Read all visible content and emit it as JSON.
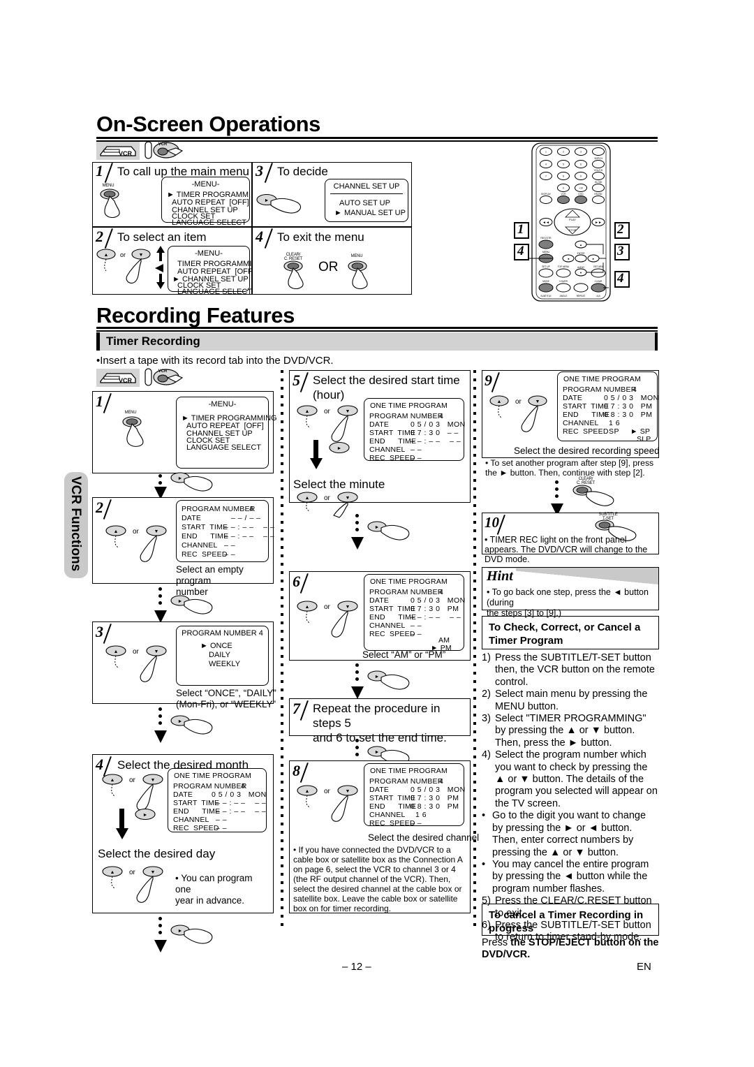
{
  "page": {
    "number": "– 12 –",
    "lang": "EN",
    "side_tab": "VCR Functions"
  },
  "headings": {
    "h1_a": "On-Screen Operations",
    "h1_b": "Recording Features",
    "section": "Timer Recording",
    "intro_bullet": "•Insert a tape with its record tab into the DVD/VCR."
  },
  "icons": {
    "vcr_deck": "vcr-deck-icon",
    "remote_vcr_press": "remote-vcr-button-press-icon",
    "menu_button": "MENU",
    "clear_button": "CLEAR/\nC. RESET",
    "subtitle_button": "SUBTITLE\nT-SET",
    "up_button": "▲",
    "down_button": "▼",
    "right_button": "►",
    "or": "or"
  },
  "onscreen": {
    "steps": [
      {
        "num": "1",
        "title": "To call up the main menu",
        "button": "MENU",
        "osd": {
          "title": "-MENU-",
          "lines": [
            "► TIMER PROGRAMMING",
            "AUTO REPEAT  [OFF]",
            "CHANNEL SET UP",
            "CLOCK SET",
            "LANGUAGE SELECT"
          ]
        }
      },
      {
        "num": "2",
        "title": "To select an item",
        "osd": {
          "title": "-MENU-",
          "lines": [
            "TIMER PROGRAMMING",
            "AUTO REPEAT  [OFF]",
            "► CHANNEL SET UP",
            "CLOCK SET",
            "LANGUAGE SELECT"
          ]
        }
      },
      {
        "num": "3",
        "title": "To decide",
        "osd": {
          "title": "CHANNEL SET UP",
          "lines": [
            "AUTO SET UP",
            "► MANUAL SET UP"
          ]
        }
      },
      {
        "num": "4",
        "title": "To exit the menu",
        "or_text": "OR",
        "buttons": [
          "CLEAR/\nC. RESET",
          "MENU"
        ]
      }
    ]
  },
  "timer": {
    "step1": {
      "num": "1",
      "osd_title": "-MENU-",
      "osd_lines": [
        "► TIMER PROGRAMMING",
        "AUTO REPEAT  [OFF]",
        "CHANNEL SET UP",
        "CLOCK SET",
        "LANGUAGE SELECT"
      ],
      "button": "MENU"
    },
    "step2": {
      "num": "2",
      "osd_rows": [
        {
          "label": "PROGRAM NUMBER",
          "value": "4",
          "flash": true
        },
        {
          "label": "DATE",
          "value": "– – / – –"
        },
        {
          "label": "START  TIME",
          "value": "– – : – –    – –"
        },
        {
          "label": "END      TIME",
          "value": "– – : – –    – –"
        },
        {
          "label": "CHANNEL",
          "value": "– –"
        },
        {
          "label": "REC  SPEED",
          "value": "– –"
        }
      ],
      "caption": "Select an empty program\nnumber"
    },
    "step3": {
      "num": "3",
      "osd_title": "PROGRAM  NUMBER  4",
      "osd_lines": [
        "► ONCE",
        "DAILY",
        "WEEKLY"
      ],
      "caption": "Select “ONCE”, “DAILY”\n(Mon-Fri), or “WEEKLY”"
    },
    "step4": {
      "num": "4",
      "title": "Select the desired month",
      "osd_title": "ONE TIME PROGRAM",
      "osd_rows": [
        {
          "label": "PROGRAM NUMBER",
          "value": "4"
        },
        {
          "label": "DATE",
          "value": "0 5 / 0 3   MON",
          "flash": true
        },
        {
          "label": "START  TIME",
          "value": "– – : – –    – –"
        },
        {
          "label": "END      TIME",
          "value": "– – : – –    – –"
        },
        {
          "label": "CHANNEL",
          "value": "– –"
        },
        {
          "label": "REC  SPEED",
          "value": "– –"
        }
      ],
      "subtitle": "Select the desired day",
      "note": "• You can program one\n  year in advance."
    },
    "step5": {
      "num": "5",
      "title": "Select the desired start time\n(hour)",
      "osd_title": "ONE TIME PROGRAM",
      "osd_rows": [
        {
          "label": "PROGRAM NUMBER",
          "value": "4"
        },
        {
          "label": "DATE",
          "value": "0 5 / 0 3   MON"
        },
        {
          "label": "START  TIME",
          "value": "0 7 : 3 0   – –",
          "flash": true
        },
        {
          "label": "END      TIME",
          "value": "– – : – –    – –"
        },
        {
          "label": "CHANNEL",
          "value": "– –"
        },
        {
          "label": "REC  SPEED",
          "value": "– –"
        }
      ],
      "subtitle": "Select the minute"
    },
    "step6": {
      "num": "6",
      "osd_title": "ONE TIME PROGRAM",
      "osd_rows": [
        {
          "label": "PROGRAM NUMBER",
          "value": "4"
        },
        {
          "label": "DATE",
          "value": "0 5 / 0 3   MON"
        },
        {
          "label": "START  TIME",
          "value": "0 7 : 3 0   PM",
          "flash": true
        },
        {
          "label": "END      TIME",
          "value": "– – : – –    – –"
        },
        {
          "label": "CHANNEL",
          "value": "– –"
        },
        {
          "label": "REC  SPEED",
          "value": "– –"
        }
      ],
      "options": [
        "AM",
        "► PM"
      ],
      "caption": "Select “AM” or “PM”"
    },
    "step7": {
      "num": "7",
      "title": "Repeat the procedure in steps 5\nand 6 to set the end time."
    },
    "step8": {
      "num": "8",
      "osd_title": "ONE TIME PROGRAM",
      "osd_rows": [
        {
          "label": "PROGRAM NUMBER",
          "value": "4"
        },
        {
          "label": "DATE",
          "value": "0 5 / 0 3   MON"
        },
        {
          "label": "START  TIME",
          "value": "0 7 : 3 0   PM"
        },
        {
          "label": "END      TIME",
          "value": "0 8 : 3 0   PM"
        },
        {
          "label": "CHANNEL",
          "value": "1 6",
          "flash": true
        },
        {
          "label": "REC  SPEED",
          "value": "– –"
        }
      ],
      "caption": "Select the desired channel",
      "note": "• If you have connected the DVD/VCR to a cable box or satellite box as the Connection A on page 6, select the VCR to channel 3 or 4 (the RF output channel of the VCR). Then, select the desired channel at the cable box or satellite box. Leave the cable box or satellite box on for timer recording."
    },
    "step9": {
      "num": "9",
      "osd_title": "ONE TIME PROGRAM",
      "osd_rows": [
        {
          "label": "PROGRAM NUMBER",
          "value": "4"
        },
        {
          "label": "DATE",
          "value": "0 5 / 0 3   MON"
        },
        {
          "label": "START  TIME",
          "value": "0 7 : 3 0   PM"
        },
        {
          "label": "END      TIME",
          "value": "0 8 : 3 0   PM"
        },
        {
          "label": "CHANNEL",
          "value": "1 6"
        },
        {
          "label": "REC  SPEED",
          "value": "SP",
          "flash": true
        }
      ],
      "options": [
        "► SP",
        "SLP"
      ],
      "caption": "Select the desired recording speed",
      "note": "• To set another program after step [9], press the\n  ► button. Then, continue with step [2]."
    },
    "step10": {
      "num": "10",
      "note": "• TIMER REC light on the front panel appears.\n  The DVD/VCR will change to the DVD mode."
    }
  },
  "hint": {
    "label": "Hint",
    "text": "• To go back one step, press the ◄ button (during\n  the steps [3] to [9].)"
  },
  "check_section": {
    "title": "To Check, Correct, or Cancel a\nTimer Program",
    "items": [
      {
        "mark": "1)",
        "text": "Press the SUBTITLE/T-SET button then, the VCR button on the remote control."
      },
      {
        "mark": "2)",
        "text": "Select main menu by pressing the MENU button."
      },
      {
        "mark": "3)",
        "text": "Select \"TIMER PROGRAMMING\" by pressing the ▲ or ▼ button. Then, press the ► button."
      },
      {
        "mark": "4)",
        "text": "Select the program number which you want to check by pressing the ▲ or ▼ button. The details of the program you selected will appear on the TV screen."
      },
      {
        "mark": "•",
        "text": "Go to the digit you want to change by pressing the ► or ◄ button. Then, enter correct numbers by pressing the ▲ or ▼ button."
      },
      {
        "mark": "•",
        "text": "You may cancel the entire program by pressing the ◄ button while the program number flashes."
      },
      {
        "mark": "5)",
        "text": "Press the CLEAR/C.RESET button to exit."
      },
      {
        "mark": "6)",
        "text": "Press the SUBTITLE/T-SET button to return to timer stand-by mode."
      }
    ]
  },
  "cancel_section": {
    "title": "To cancel a Timer Recording in\nprogress",
    "text_plain": "Press ",
    "text_bold": "the STOP/EJECT button on the DVD/VCR."
  },
  "remote": {
    "name": "remote-control-illustration",
    "callouts": [
      "2",
      "3",
      "1",
      "4",
      "2",
      "3",
      "4"
    ],
    "keys": [
      "1",
      "2",
      "3",
      "4",
      "5",
      "6",
      "7",
      "8",
      "9",
      "0",
      "+10",
      "DISPLAY",
      "VCR",
      "DVD",
      "PAUSE",
      "PLAY",
      "STOP",
      "REC/OTR",
      "MENU",
      "ENTER",
      "SET UP",
      "TOP MENU",
      "RETURN",
      "MODE",
      "V.SURR",
      "AUDIO",
      "CLEAR/C.RESET",
      "SUBTITLE/T-SET",
      "ANGLE",
      "REPEAT",
      "A-B"
    ]
  }
}
